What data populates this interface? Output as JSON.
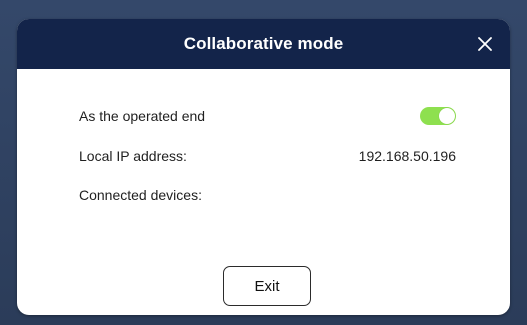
{
  "dialog": {
    "title": "Collaborative mode",
    "close_icon": "close-icon",
    "operated_end": {
      "label": "As the operated end",
      "enabled": true,
      "toggle_color": "#8ee04f"
    },
    "local_ip": {
      "label": "Local IP address:",
      "value": "192.168.50.196"
    },
    "connected_devices": {
      "label": "Connected devices:",
      "value": ""
    },
    "exit_label": "Exit"
  },
  "colors": {
    "header_bg": "#13244a",
    "backdrop": "#2b3c59",
    "dialog_bg": "#ffffff"
  }
}
